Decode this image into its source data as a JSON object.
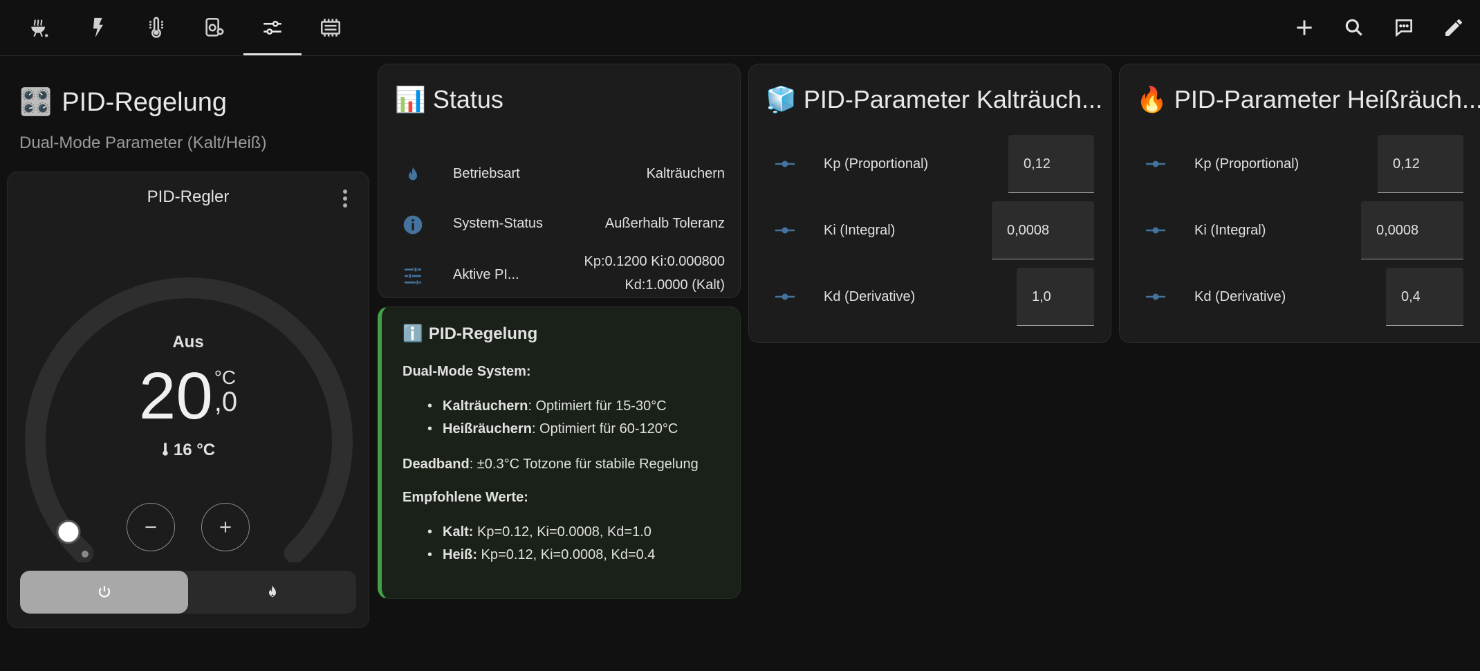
{
  "nav": {
    "tabs": [
      {
        "name": "grill-icon",
        "active": false
      },
      {
        "name": "lightning-icon",
        "active": false
      },
      {
        "name": "thermometer-icon",
        "active": false
      },
      {
        "name": "camera-gear-icon",
        "active": false
      },
      {
        "name": "tune-sliders-icon",
        "active": true
      },
      {
        "name": "chip-icon",
        "active": false
      }
    ],
    "actions": [
      "add-icon",
      "search-icon",
      "chat-icon",
      "edit-icon"
    ]
  },
  "page": {
    "emoji": "🎛️",
    "title": "PID-Regelung",
    "subtitle": "Dual-Mode Parameter (Kalt/Heiß)"
  },
  "thermostat": {
    "title": "PID-Regler",
    "mode": "Aus",
    "target_int": "20",
    "target_dec": ",0",
    "unit": "°C",
    "current": "16 °C",
    "target_value": 20,
    "accent": "#ffffff"
  },
  "status": {
    "emoji": "📊",
    "title": "Status",
    "rows": [
      {
        "icon": "flame-icon",
        "label": "Betriebsart",
        "value": "Kalträuchern"
      },
      {
        "icon": "info-icon",
        "label": "System-Status",
        "value": "Außerhalb Toleranz"
      },
      {
        "icon": "tune-icon",
        "label": "Aktive PI...",
        "value_line1": "Kp:0.1200 Ki:0.000800",
        "value_line2": "Kd:1.0000 (Kalt)"
      }
    ],
    "icon_color": "#44739e"
  },
  "info": {
    "emoji": "ℹ️",
    "title": "PID-Regelung",
    "dual_mode_heading": "Dual-Mode System:",
    "kalt_label": "Kalträuchern",
    "kalt_text": ": Optimiert für 15-30°C",
    "heiss_label": "Heißräuchern",
    "heiss_text": ": Optimiert für 60-120°C",
    "deadband_label": "Deadband",
    "deadband_text": ": ±0.3°C Totzone für stabile Regelung",
    "recommended_heading": "Empfohlene Werte:",
    "rec_kalt_label": "Kalt:",
    "rec_kalt_text": " Kp=0.12, Ki=0.0008, Kd=1.0",
    "rec_heiss_label": "Heiß:",
    "rec_heiss_text": " Kp=0.12, Ki=0.0008, Kd=0.4",
    "accent": "#43a047"
  },
  "params_kalt": {
    "emoji": "🧊",
    "title": "PID-Parameter Kalträuch...",
    "rows": [
      {
        "label": "Kp (Proportional)",
        "value": "0,12"
      },
      {
        "label": "Ki (Integral)",
        "value": "0,0008"
      },
      {
        "label": "Kd (Derivative)",
        "value": "1,0"
      }
    ]
  },
  "params_heiss": {
    "emoji": "🔥",
    "title": "PID-Parameter Heißräuch...",
    "rows": [
      {
        "label": "Kp (Proportional)",
        "value": "0,12"
      },
      {
        "label": "Ki (Integral)",
        "value": "0,0008"
      },
      {
        "label": "Kd (Derivative)",
        "value": "0,4"
      }
    ]
  }
}
